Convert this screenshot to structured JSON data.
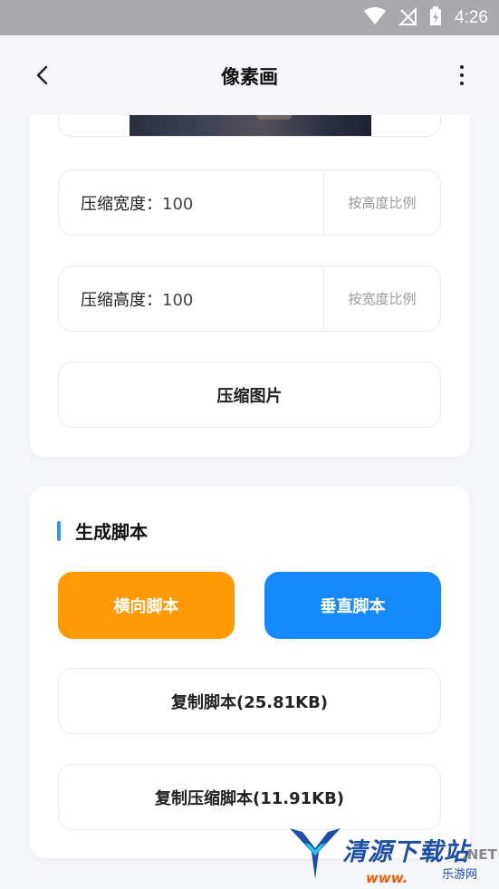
{
  "status_bar": {
    "time": "4:26",
    "icons": [
      "wifi-icon",
      "no-signal-icon",
      "battery-charging-icon"
    ]
  },
  "app_bar": {
    "title": "像素画",
    "back_icon": "back-arrow-icon",
    "more_icon": "more-vertical-icon"
  },
  "compress_card": {
    "width_label": "压缩宽度：",
    "width_value": "100",
    "width_action": "按高度比例",
    "height_label": "压缩高度：",
    "height_value": "100",
    "height_action": "按宽度比例",
    "compress_button": "压缩图片"
  },
  "script_card": {
    "section_title": "生成脚本",
    "horizontal_button": "横向脚本",
    "vertical_button": "垂直脚本",
    "copy_script": "复制脚本(25.81KB)",
    "copy_compressed_script": "复制压缩脚本(11.91KB)"
  },
  "colors": {
    "accent_orange": "#ff9a05",
    "accent_blue": "#1489fb",
    "title_accent": "#2f95f5"
  },
  "watermark": {
    "main": "清源下载站",
    "net": ".NET",
    "sub": "乐游网",
    "url": "www."
  }
}
